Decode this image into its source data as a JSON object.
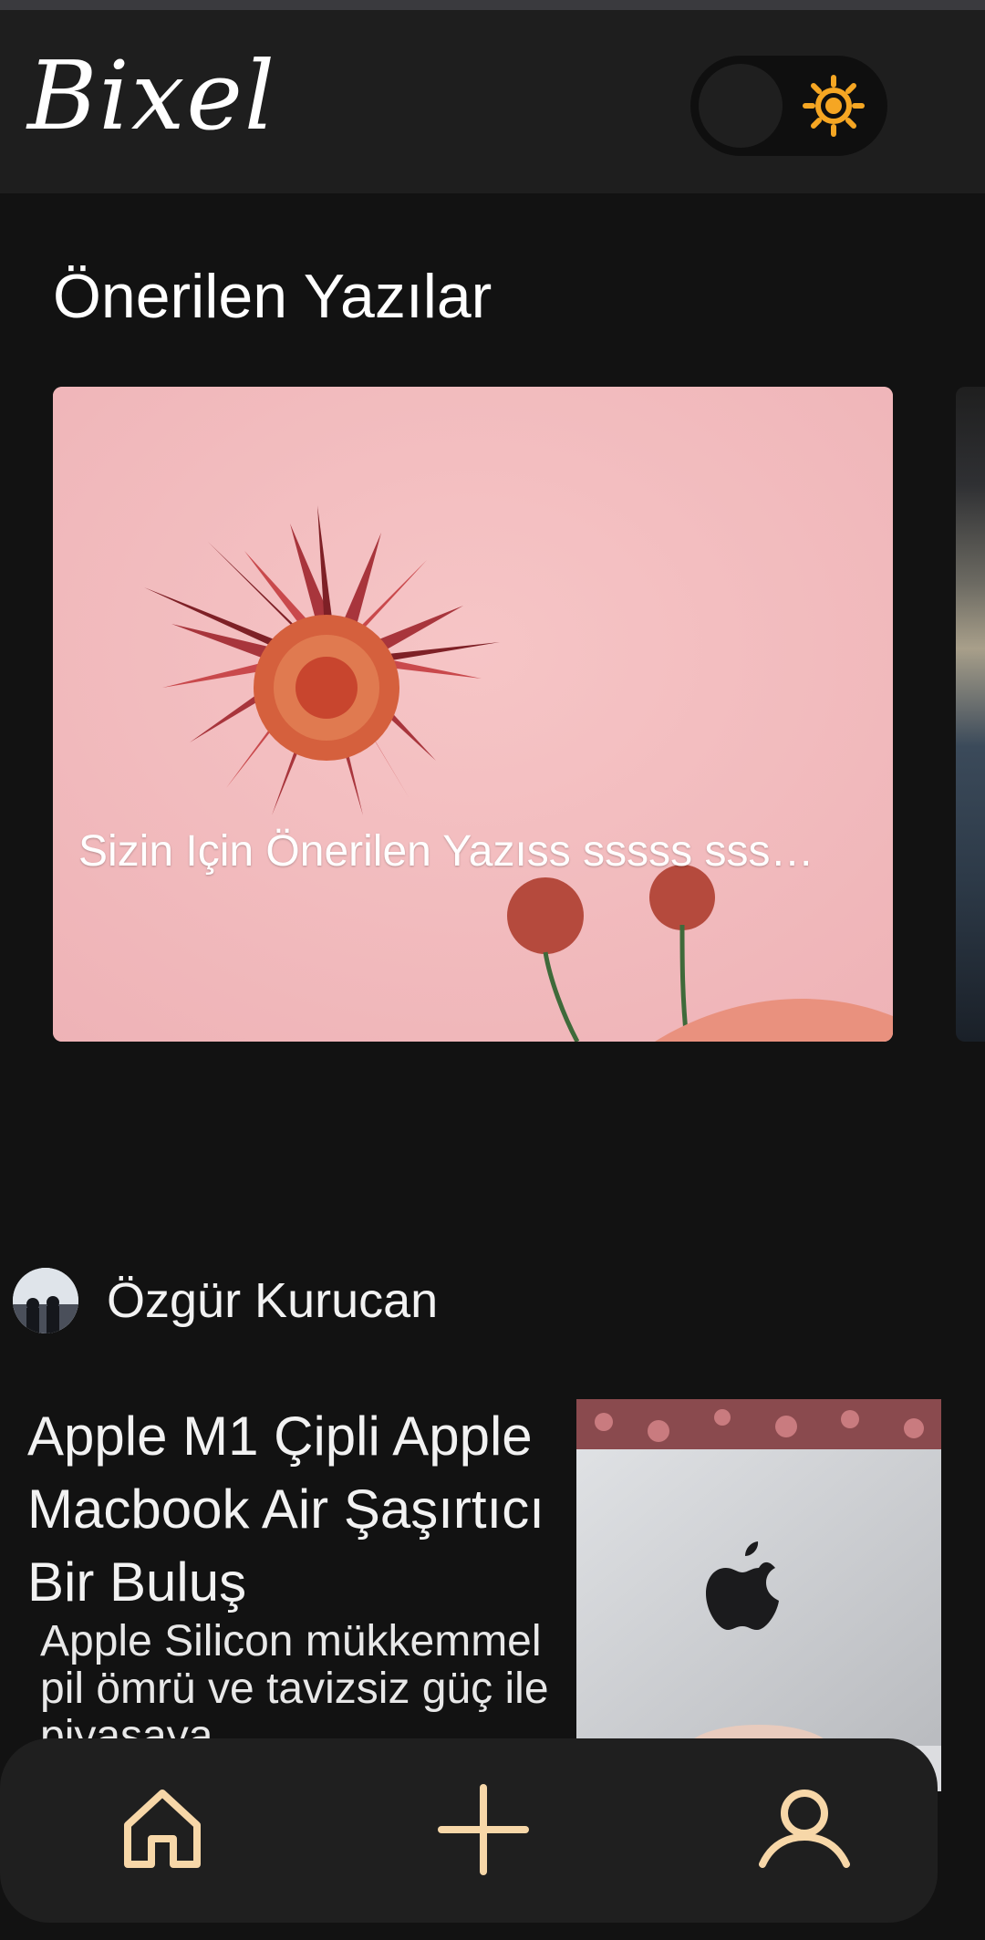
{
  "header": {
    "logo_text": "Bixel",
    "theme_toggle": {
      "state": "dark",
      "icon": "sun-icon",
      "icon_color": "#F5A623"
    }
  },
  "recommended": {
    "section_title": "Önerilen Yazılar",
    "cards": [
      {
        "title": "Sizin Için Önerilen Yazıss sssss sss…",
        "image": "red-flowers-on-pink-background"
      }
    ]
  },
  "post": {
    "author": {
      "name": "Özgür Kurucan",
      "avatar": "avatar-people-silhouette"
    },
    "title": "Apple M1 Çipli Apple Macbook Air Şaşırtıcı Bir Buluş",
    "excerpt": "Apple Silicon mükkemmel pil ömrü ve taviz­siz güç ile piyasaya",
    "image": "macbook-apple-logo"
  },
  "bottom_nav": {
    "items": [
      {
        "name": "home",
        "icon": "home-icon"
      },
      {
        "name": "add",
        "icon": "plus-icon"
      },
      {
        "name": "profile",
        "icon": "user-icon"
      }
    ],
    "icon_color": "#F7D7A8"
  }
}
